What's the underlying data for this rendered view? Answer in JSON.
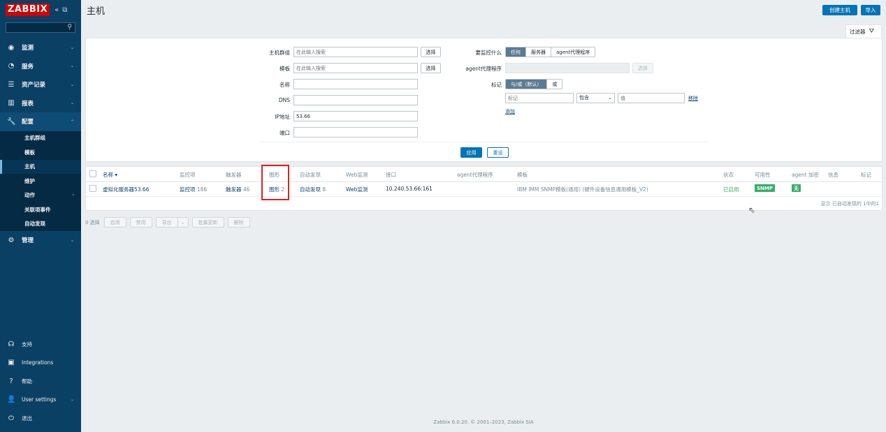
{
  "sidebar": {
    "logo": "ZABBIX",
    "collapse_label": "«",
    "kiosk_label": "⧉",
    "search_placeholder": "",
    "menu": [
      {
        "label": "监测"
      },
      {
        "label": "服务"
      },
      {
        "label": "资产记录"
      },
      {
        "label": "报表"
      },
      {
        "label": "配置"
      },
      {
        "label": "管理"
      }
    ],
    "submenu": [
      {
        "label": "主机群组"
      },
      {
        "label": "模板"
      },
      {
        "label": "主机"
      },
      {
        "label": "维护"
      },
      {
        "label": "动作"
      },
      {
        "label": "关联项事件"
      },
      {
        "label": "自动发现"
      }
    ],
    "bottom": [
      {
        "label": "支持"
      },
      {
        "label": "Integrations"
      },
      {
        "label": "帮助"
      },
      {
        "label": "User settings"
      },
      {
        "label": "退出"
      }
    ]
  },
  "header": {
    "title": "主机",
    "create_host": "创建主机",
    "import": "导入",
    "filter_tab": "过滤器"
  },
  "filter": {
    "host_groups_label": "主机群组",
    "host_groups_placeholder": "在此输入搜索",
    "select_label": "选择",
    "templates_label": "模板",
    "templates_placeholder": "在此输入搜索",
    "name_label": "名称",
    "dns_label": "DNS",
    "ip_label": "IP地址",
    "ip_value": "53.66",
    "port_label": "端口",
    "monitored_by_label": "要监控什么",
    "monitored_by_options": [
      "任何",
      "服务器",
      "agent代理程序"
    ],
    "proxy_label": "agent代理程序",
    "proxy_select": "选择",
    "tags_label": "标记",
    "tags_mode_options": [
      "与/或（默认）",
      "或"
    ],
    "tag_placeholder": "标记",
    "tag_operator": "包含",
    "tag_value_placeholder": "值",
    "remove_label": "移除",
    "add_label": "添加",
    "apply": "应用",
    "reset": "重设"
  },
  "table": {
    "columns": [
      "名称 ▾",
      "监控项",
      "触发器",
      "图形",
      "自动发现",
      "Web监测",
      "接口",
      "agent代理程序",
      "模板",
      "状态",
      "可用性",
      "agent 加密",
      "信息",
      "标记"
    ],
    "rows": [
      {
        "name": "虚拟化服务器53.66",
        "items": "监控项",
        "items_count": "186",
        "triggers": "触发器",
        "triggers_count": "46",
        "graphs": "图形",
        "graphs_count": "2",
        "discovery": "自动发现",
        "discovery_count": "8",
        "web": "Web监测",
        "interface": "10.240.53.66:161",
        "proxy": "",
        "templates": "IBM IMM SNMP模板(通用) (硬件设备信息通用模板_V2)",
        "status": "已启用",
        "availability": "SNMP",
        "encryption": "无"
      }
    ],
    "summary": "显示 已自动发现的 1中的1"
  },
  "mass_actions": {
    "selected": "0 选择",
    "buttons": [
      "启用",
      "禁用",
      "导出",
      "批量更新",
      "删除"
    ]
  },
  "footer": "Zabbix 6.0.20. © 2001–2023, Zabbix SIA"
}
